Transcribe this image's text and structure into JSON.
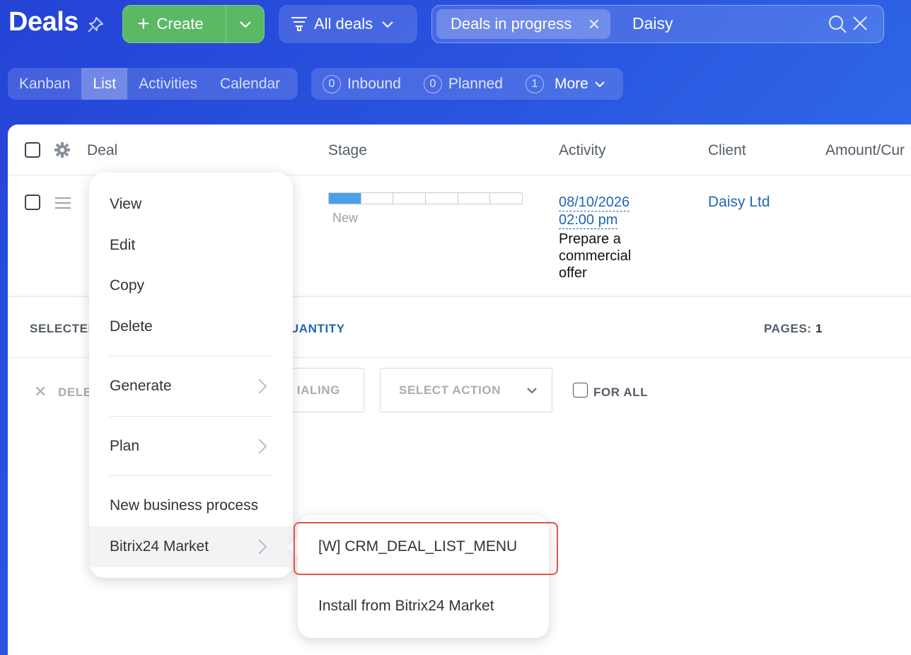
{
  "header": {
    "title": "Deals",
    "create_label": "Create",
    "all_deals_label": "All deals",
    "filter_chip": "Deals in progress",
    "search_value": "Daisy"
  },
  "view_tabs": [
    {
      "label": "Kanban",
      "active": false
    },
    {
      "label": "List",
      "active": true
    },
    {
      "label": "Activities",
      "active": false
    },
    {
      "label": "Calendar",
      "active": false
    }
  ],
  "counters": [
    {
      "count": "0",
      "label": "Inbound"
    },
    {
      "count": "0",
      "label": "Planned"
    },
    {
      "count": "1",
      "label": "More"
    }
  ],
  "table": {
    "columns": [
      "Deal",
      "Stage",
      "Activity",
      "Client",
      "Amount/Cur"
    ],
    "rows": [
      {
        "stage": "New",
        "stage_progress": 0.166,
        "activity_date": "08/10/2026",
        "activity_time": "02:00 pm",
        "activity_desc": "Prepare a commercial offer",
        "client": "Daisy Ltd"
      }
    ]
  },
  "footer": {
    "selected_label": "SELECTED",
    "quantity_label": "QUANTITY",
    "pages_label": "PAGES:",
    "pages_value": "1",
    "delete_label": "DELE",
    "dialing_label": "IALING",
    "select_action": "SELECT ACTION",
    "for_all": "FOR ALL"
  },
  "context_menu": {
    "items": [
      "View",
      "Edit",
      "Copy",
      "Delete",
      "Generate",
      "Plan",
      "New business process",
      "Bitrix24 Market"
    ]
  },
  "submenu": {
    "items": [
      "[W] CRM_DEAL_LIST_MENU",
      "Install from Bitrix24 Market"
    ]
  },
  "colors": {
    "create_green": "#5bb865",
    "link_blue": "#2067b0",
    "highlight_red": "#e2534a",
    "progress_blue": "#4d9ee8"
  }
}
